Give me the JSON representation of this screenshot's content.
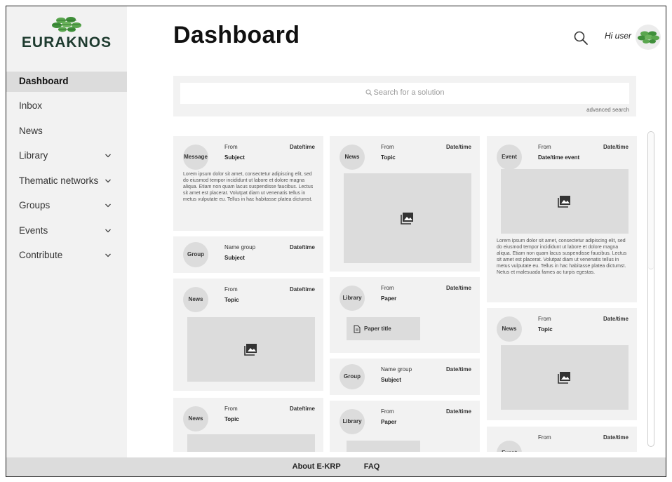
{
  "brand": {
    "name": "EURAKNOS",
    "logo_icon": "leaf-cluster-logo"
  },
  "sidebar": {
    "items": [
      {
        "label": "Dashboard",
        "active": true,
        "expandable": false
      },
      {
        "label": "Inbox",
        "expandable": false
      },
      {
        "label": "News",
        "expandable": false
      },
      {
        "label": "Library",
        "expandable": true
      },
      {
        "label": "Thematic networks",
        "expandable": true
      },
      {
        "label": "Groups",
        "expandable": true
      },
      {
        "label": "Events",
        "expandable": true
      },
      {
        "label": "Contribute",
        "expandable": true
      }
    ]
  },
  "header": {
    "title": "Dashboard",
    "greeting": "Hi user"
  },
  "search": {
    "placeholder": "Search for a solution",
    "advanced_label": "advanced search"
  },
  "lorem_short": "Lorem ipsum dolor sit amet, consectetur adipiscing elit, sed do eiusmod tempor incididunt ut labore et dolore magna aliqua. Etiam non quam lacus suspendisse faucibus. Lectus sit amet est placerat. Volutpat diam ut venenatis tellus in metus vulputate eu. Tellus in hac habitasse platea dictumst.",
  "lorem_long": "Lorem ipsum dolor sit amet, consectetur adipiscing elit, sed do eiusmod tempor incididunt ut labore et dolore magna aliqua. Etiam non quam lacus suspendisse faucibus. Lectus sit amet est placerat. Volutpat diam ut venenatis tellus in metus vulputate eu. Tellus in hac habitasse platea dictumst. Netus et malesuada fames ac turpis egestas.",
  "feed": {
    "col1": [
      {
        "chip": "Message",
        "from": "From",
        "second": "Subject",
        "datetime": "Date/time"
      },
      {
        "chip": "Group",
        "from": "Name group",
        "second": "Subject",
        "datetime": "Date/time"
      },
      {
        "chip": "News",
        "from": "From",
        "second": "Topic",
        "datetime": "Date/time"
      },
      {
        "chip": "News",
        "from": "From",
        "second": "Topic",
        "datetime": "Date/time"
      }
    ],
    "col2": [
      {
        "chip": "News",
        "from": "From",
        "second": "Topic",
        "datetime": "Date/time"
      },
      {
        "chip": "Library",
        "from": "From",
        "second": "Paper",
        "datetime": "Date/time",
        "paper_title": "Paper title"
      },
      {
        "chip": "Group",
        "from": "Name group",
        "second": "Subject",
        "datetime": "Date/time"
      },
      {
        "chip": "Library",
        "from": "From",
        "second": "Paper",
        "datetime": "Date/time"
      }
    ],
    "col3": [
      {
        "chip": "Event",
        "from": "From",
        "second": "Date/time event",
        "datetime": "Date/time"
      },
      {
        "chip": "News",
        "from": "From",
        "second": "Topic",
        "datetime": "Date/time"
      },
      {
        "chip": "Event",
        "from": "From",
        "second": "",
        "datetime": "Date/time"
      }
    ]
  },
  "footer": {
    "links": [
      "About E-KRP",
      "FAQ"
    ]
  },
  "colors": {
    "brand_green": "#3f8f3a",
    "brand_dark": "#1e3b2f",
    "card_bg": "#f2f2f2",
    "placeholder_bg": "#dcdcdc"
  }
}
